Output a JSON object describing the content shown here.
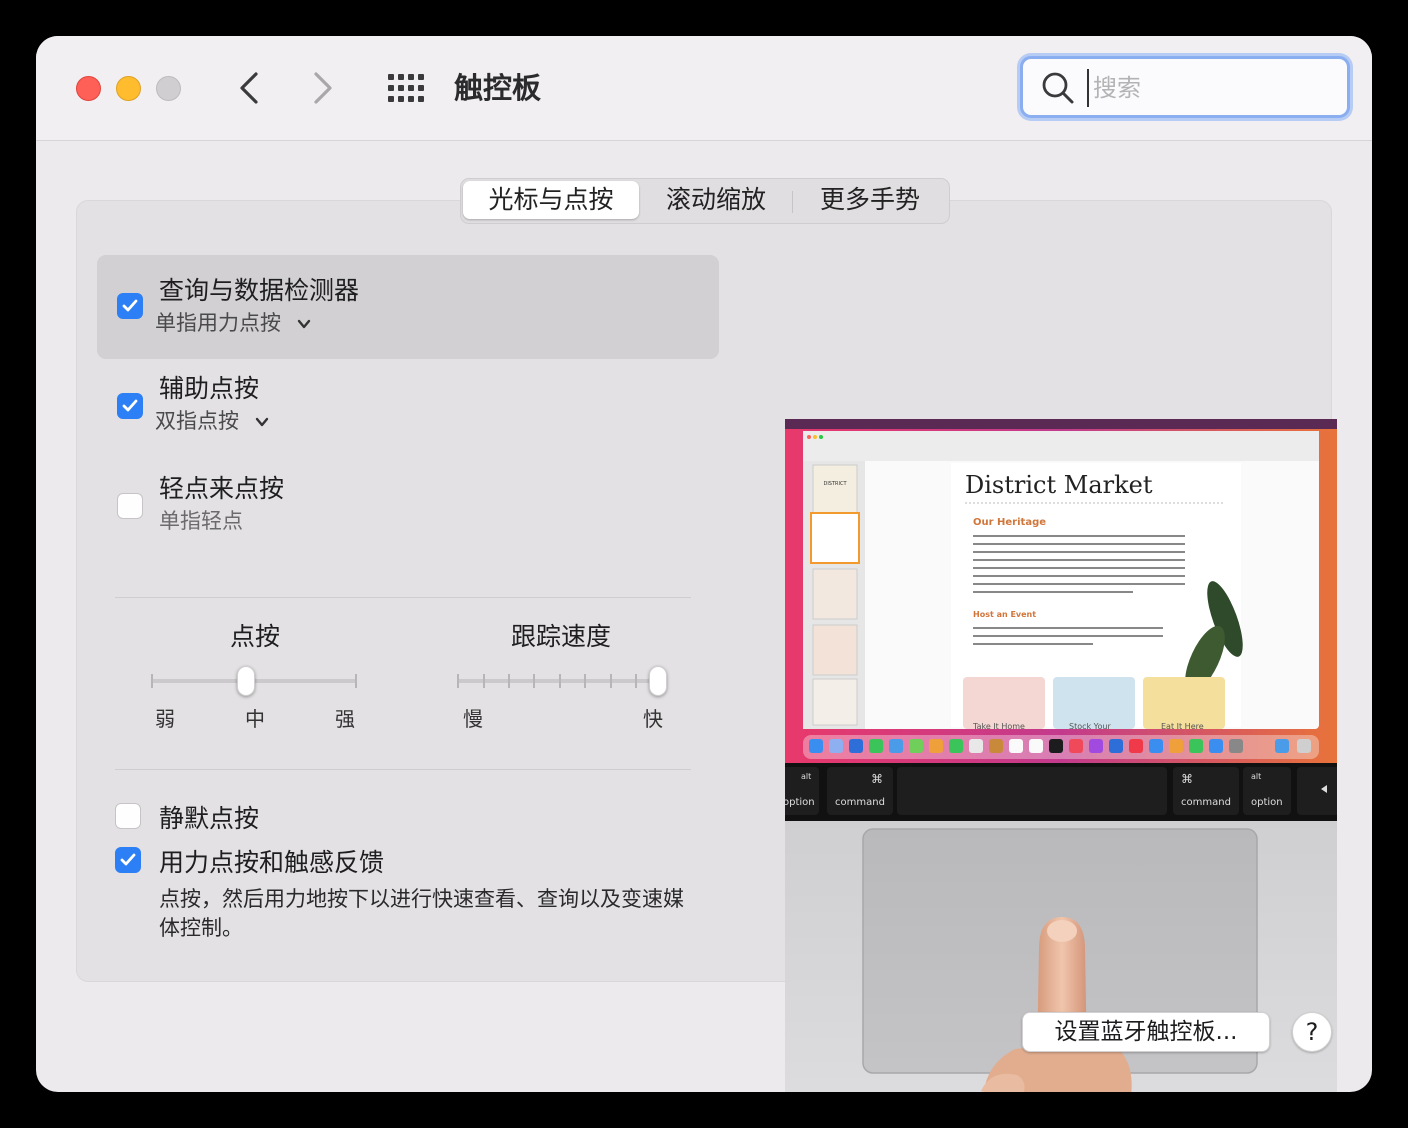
{
  "window": {
    "title": "触控板",
    "search_placeholder": "搜索"
  },
  "tabs": [
    {
      "label": "光标与点按",
      "active": true
    },
    {
      "label": "滚动缩放",
      "active": false
    },
    {
      "label": "更多手势",
      "active": false
    }
  ],
  "options": {
    "lookup": {
      "title": "查询与数据检测器",
      "sub": "单指用力点按",
      "checked": true
    },
    "secondary": {
      "title": "辅助点按",
      "sub": "双指点按",
      "checked": true
    },
    "tap": {
      "title": "轻点来点按",
      "sub": "单指轻点",
      "checked": false
    }
  },
  "sliders": {
    "click": {
      "title": "点按",
      "labels": [
        "弱",
        "中",
        "强"
      ],
      "value": "中"
    },
    "tracking": {
      "title": "跟踪速度",
      "min_label": "慢",
      "max_label": "快",
      "value_fraction": 1.0
    }
  },
  "bottom_options": {
    "silent": {
      "title": "静默点按",
      "checked": false
    },
    "force": {
      "title": "用力点按和触感反馈",
      "checked": true,
      "desc": "点按，然后用力地按下以进行快速查看、查询以及变速媒体控制。"
    }
  },
  "preview": {
    "doc_title": "District Market",
    "heading1": "Our Heritage",
    "heading2": "Host an Event",
    "card1": "Take It Home",
    "card2": "Stock Your",
    "card3": "Eat It Here",
    "thumb_label": "DISTRICT",
    "keys": {
      "option_left": "option",
      "command_left": "command",
      "command_right": "command",
      "option_right": "option",
      "alt": "alt",
      "cmd_symbol": "⌘"
    }
  },
  "buttons": {
    "bluetooth": "设置蓝牙触控板...",
    "help": "?"
  },
  "colors": {
    "accent": "#2c7ff5",
    "search_focus": "#8aaef0"
  }
}
